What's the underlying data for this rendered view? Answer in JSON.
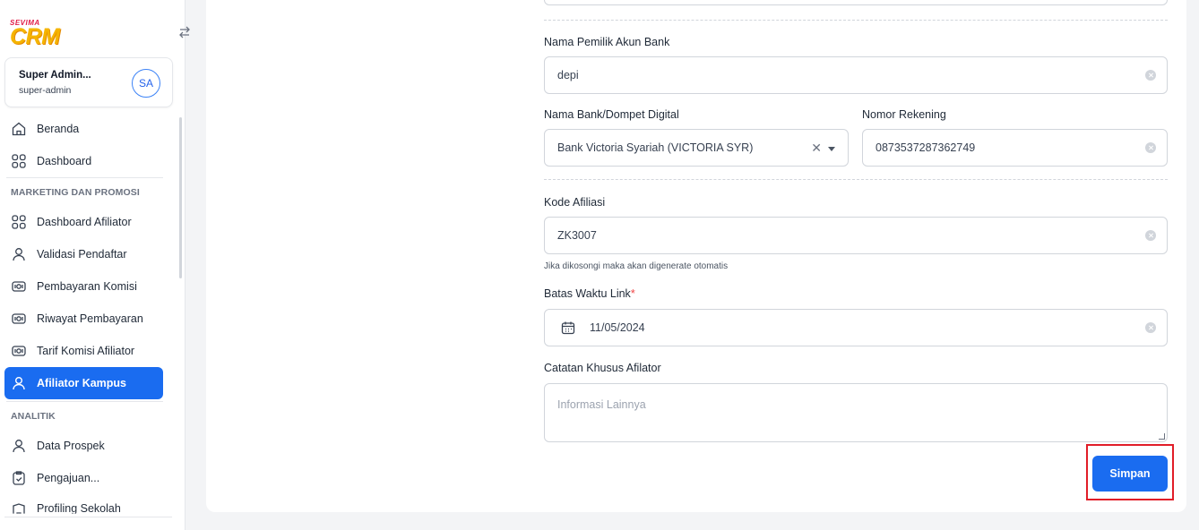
{
  "brand": {
    "top": "SEVIMA",
    "name": "CRM"
  },
  "user": {
    "name": "Super Admin...",
    "role": "super-admin",
    "initials": "SA"
  },
  "nav": {
    "beranda": "Beranda",
    "dashboard": "Dashboard",
    "section_marketing": "MARKETING DAN PROMOSI",
    "dashboard_afiliator": "Dashboard Afiliator",
    "validasi_pendaftar": "Validasi Pendaftar",
    "pembayaran_komisi": "Pembayaran Komisi",
    "riwayat_pembayaran": "Riwayat Pembayaran",
    "tarif_komisi": "Tarif Komisi Afiliator",
    "afiliator_kampus": "Afiliator Kampus",
    "section_analitik": "ANALITIK",
    "data_prospek": "Data Prospek",
    "pengajuan": "Pengajuan...",
    "profiling_sekolah": "Profiling Sekolah"
  },
  "form": {
    "owner_label": "Nama Pemilik Akun Bank",
    "owner_value": "depi",
    "bank_label": "Nama Bank/Dompet Digital",
    "bank_value": "Bank Victoria Syariah (VICTORIA SYR)",
    "account_label": "Nomor Rekening",
    "account_value": "0873537287362749",
    "code_label": "Kode Afiliasi",
    "code_value": "ZK3007",
    "code_hint": "Jika dikosongi maka akan digenerate otomatis",
    "deadline_label": "Batas Waktu Link",
    "deadline_required": "*",
    "deadline_value": "11/05/2024",
    "notes_label": "Catatan Khusus Afilator",
    "notes_placeholder": "Informasi Lainnya",
    "save_label": "Simpan"
  },
  "colors": {
    "primary": "#1a6cf0",
    "highlight": "#e11d28",
    "brand_yellow": "#f5b400"
  }
}
